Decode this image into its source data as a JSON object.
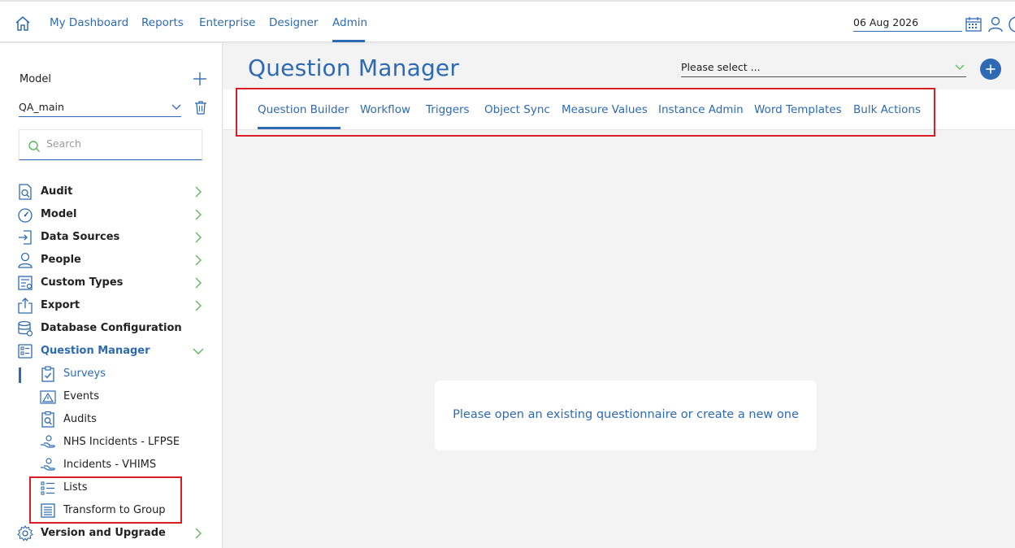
{
  "topnav": {
    "items": [
      "My Dashboard",
      "Reports",
      "Enterprise",
      "Designer",
      "Admin"
    ],
    "active": "Admin",
    "date": "06 Aug 2026"
  },
  "sidebar": {
    "title": "Model",
    "model_value": "QA_main",
    "search_placeholder": "Search",
    "items": [
      {
        "label": "Audit",
        "icon": "audit-icon"
      },
      {
        "label": "Model",
        "icon": "gauge-icon"
      },
      {
        "label": "Data Sources",
        "icon": "import-icon"
      },
      {
        "label": "People",
        "icon": "person-icon"
      },
      {
        "label": "Custom Types",
        "icon": "custom-types-icon"
      },
      {
        "label": "Export",
        "icon": "export-icon"
      },
      {
        "label": "Database Configuration",
        "icon": "database-icon"
      },
      {
        "label": "Question Manager",
        "icon": "question-manager-icon"
      }
    ],
    "sub_items": [
      {
        "label": "Surveys",
        "icon": "survey-icon"
      },
      {
        "label": "Events",
        "icon": "warning-icon"
      },
      {
        "label": "Audits",
        "icon": "audit-icon"
      },
      {
        "label": "NHS Incidents - LFPSE",
        "icon": "hand-icon"
      },
      {
        "label": "Incidents - VHIMS",
        "icon": "hand-icon"
      },
      {
        "label": "Lists",
        "icon": "list-icon"
      },
      {
        "label": "Transform to Group",
        "icon": "transform-icon"
      }
    ],
    "last_item": {
      "label": "Version and Upgrade",
      "icon": "gear-icon"
    }
  },
  "main": {
    "title": "Question Manager",
    "select_placeholder": "Please select ...",
    "tabs": [
      "Question Builder",
      "Workflow",
      "Triggers",
      "Object Sync",
      "Measure Values",
      "Instance Admin",
      "Word Templates",
      "Bulk Actions"
    ],
    "active_tab": "Question Builder",
    "empty_message": "Please open an existing questionnaire or create a new one"
  },
  "colors": {
    "accent": "#2e6ab3",
    "highlight": "#d81f26",
    "chevron": "#5cb85c"
  }
}
